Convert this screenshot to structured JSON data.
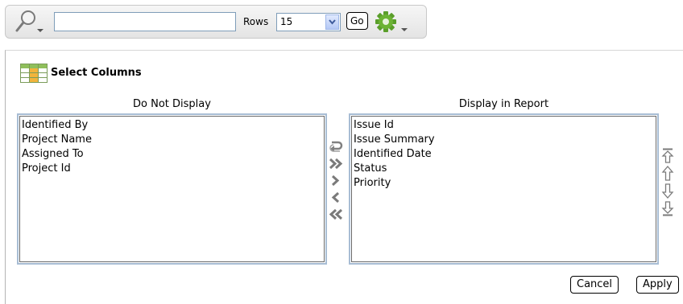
{
  "toolbar": {
    "search_value": "",
    "rows_label": "Rows",
    "rows_value": "15",
    "go_label": "Go"
  },
  "panel": {
    "title": "Select Columns",
    "left_heading": "Do Not Display",
    "right_heading": "Display in Report",
    "left_items": [
      "Identified By",
      "Project Name",
      "Assigned To",
      "Project Id"
    ],
    "right_items": [
      "Issue Id",
      "Issue Summary",
      "Identified Date",
      "Status",
      "Priority"
    ],
    "cancel_label": "Cancel",
    "apply_label": "Apply"
  },
  "icons": {
    "search": "search-icon",
    "gear": "gear-icon",
    "select_columns": "table-icon"
  },
  "colors": {
    "accent_green": "#5a9e2a",
    "list_border": "#a8bdd4",
    "select_arrow": "#b4c8f6"
  }
}
